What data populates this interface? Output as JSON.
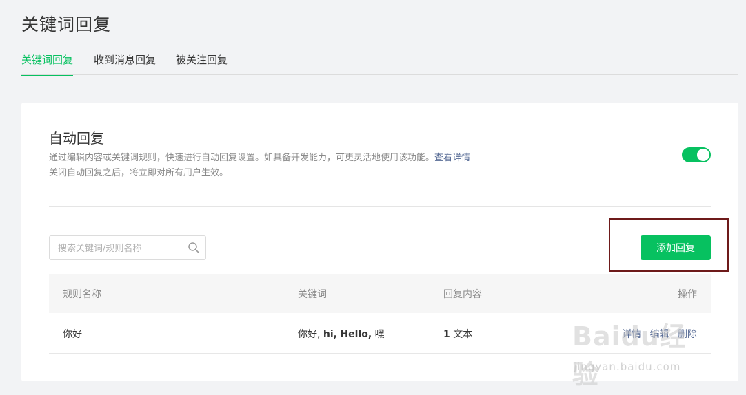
{
  "page": {
    "title": "关键词回复"
  },
  "tabs": [
    {
      "label": "关键词回复",
      "active": true
    },
    {
      "label": "收到消息回复",
      "active": false
    },
    {
      "label": "被关注回复",
      "active": false
    }
  ],
  "auto_reply": {
    "title": "自动回复",
    "desc_line1": "通过编辑内容或关键词规则，快速进行自动回复设置。如具备开发能力，可更灵活地使用该功能。",
    "desc_link": "查看详情",
    "desc_line2": "关闭自动回复之后，将立即对所有用户生效。",
    "enabled": true
  },
  "search": {
    "placeholder": "搜索关键词/规则名称",
    "value": ""
  },
  "add_button_label": "添加回复",
  "table": {
    "headers": {
      "name": "规则名称",
      "keywords": "关键词",
      "content": "回复内容",
      "actions": "操作"
    },
    "rows": [
      {
        "name": "你好",
        "kw_1": "你好,",
        "kw_2": "hi,",
        "kw_3": "Hello,",
        "kw_4": "嘿",
        "content_count": "1",
        "content_type": "文本",
        "action_detail": "详情",
        "action_edit": "编辑",
        "action_delete": "删除"
      }
    ]
  },
  "watermark": {
    "logo": "Baidu经验",
    "url": "jingyan.baidu.com"
  },
  "colors": {
    "accent": "#07c160",
    "link": "#576b95",
    "highlight_box": "#6e1a1a"
  }
}
